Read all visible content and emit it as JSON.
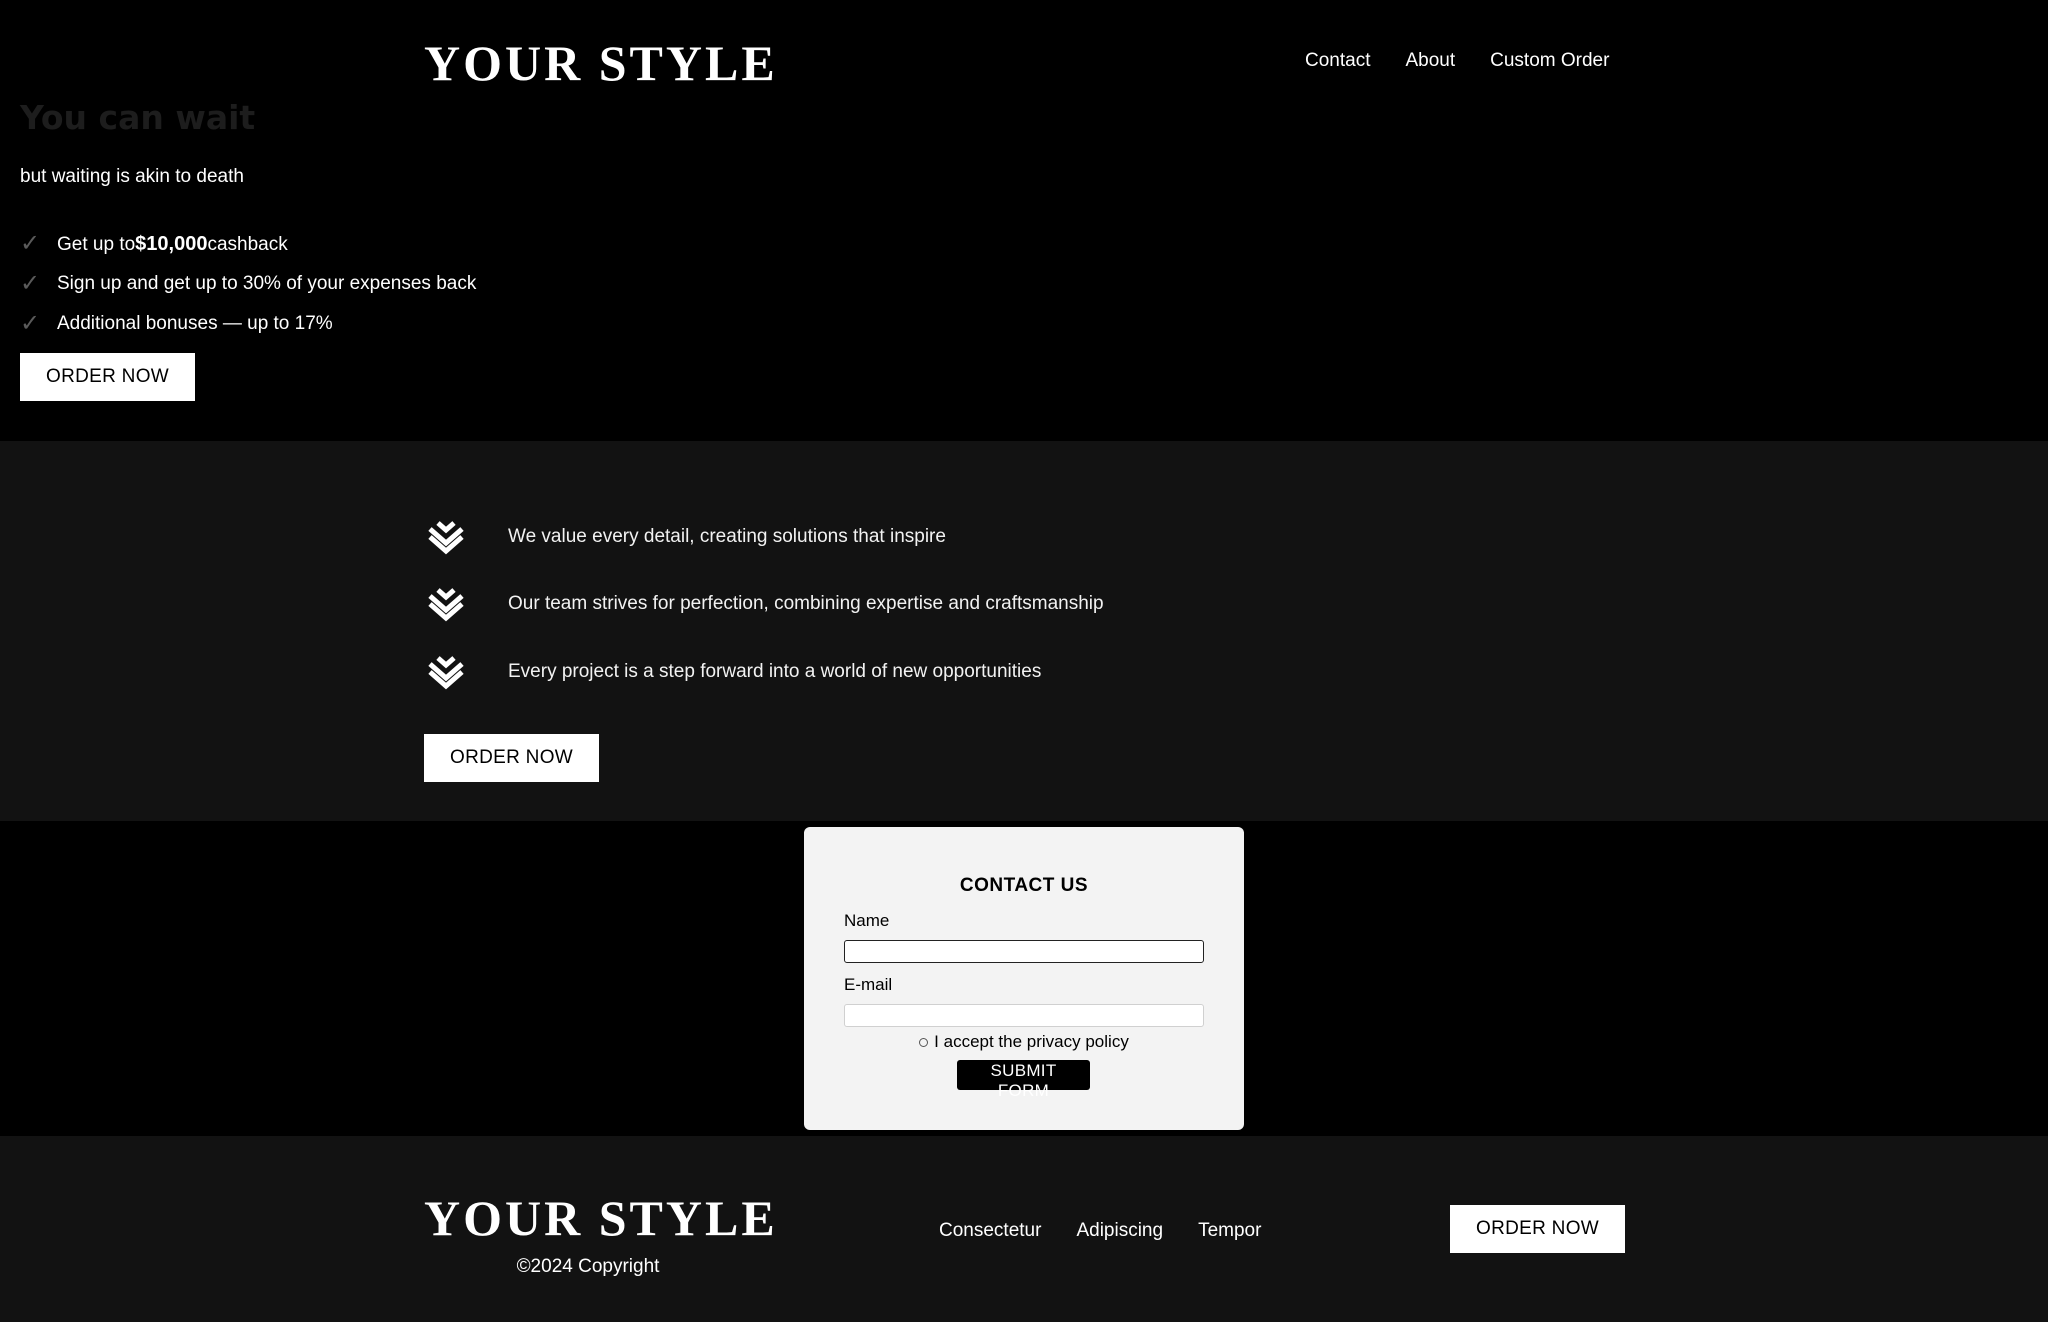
{
  "brand": {
    "logo_text": "YOUR STYLE"
  },
  "header": {
    "nav": [
      "Contact",
      "About",
      "Custom Order"
    ]
  },
  "hero": {
    "title": "You can wait",
    "subtitle": "but waiting is akin to death",
    "benefits": [
      {
        "icon": "check-icon",
        "prefix": "Get up to",
        "bold": "$10,000",
        "suffix": "cashback"
      },
      {
        "icon": "check-icon",
        "prefix": "Sign up and get up to 30% of your expenses back",
        "bold": "",
        "suffix": ""
      },
      {
        "icon": "check-icon",
        "prefix": "Additional bonuses — up to 17%",
        "bold": "",
        "suffix": ""
      }
    ],
    "cta_label": "ORDER NOW"
  },
  "features": {
    "items": [
      {
        "icon": "layers-chevron-icon",
        "text": "We value every detail, creating solutions that inspire"
      },
      {
        "icon": "layers-chevron-icon",
        "text": "Our team strives for perfection, combining expertise and craftsmanship"
      },
      {
        "icon": "layers-chevron-icon",
        "text": "Every project is a step forward into a world of new opportunities"
      }
    ],
    "cta_label": "ORDER NOW"
  },
  "contact": {
    "title": "CONTACT US",
    "name_label": "Name",
    "name_value": "",
    "email_label": "E-mail",
    "email_value": "",
    "policy_label": "I accept the privacy policy",
    "submit_label": "SUBMIT FORM"
  },
  "footer": {
    "copyright": "©2024 Copyright",
    "links": [
      "Consectetur",
      "Adipiscing",
      "Tempor"
    ],
    "cta_label": "ORDER NOW"
  },
  "colors": {
    "background": "#000000",
    "section_alt": "#121212",
    "card": "#f3f3f3",
    "check": "#5a5a5a"
  }
}
